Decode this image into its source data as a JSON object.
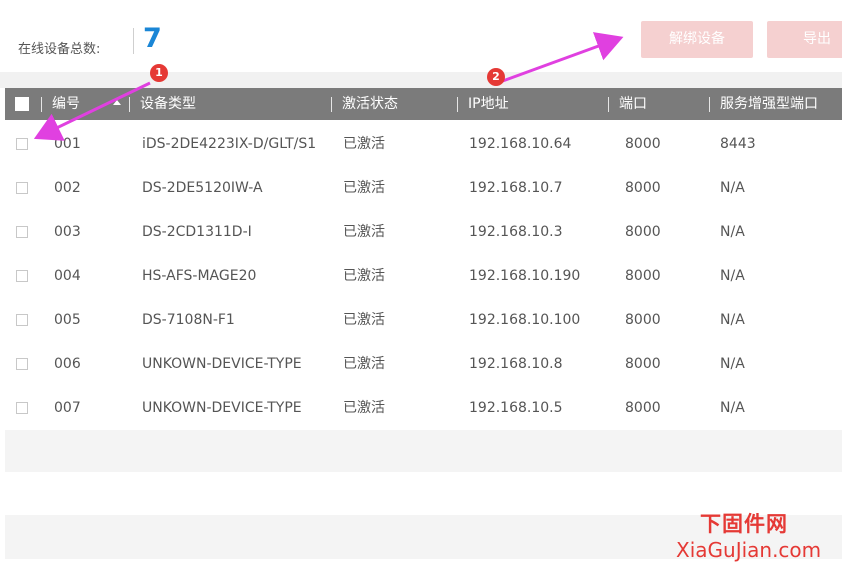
{
  "summary": {
    "online_label": "在线设备总数:",
    "online_count": "7"
  },
  "toolbar": {
    "unbind_label": "解绑设备",
    "export_label": "导出"
  },
  "table": {
    "columns": [
      "编号",
      "设备类型",
      "激活状态",
      "IP地址",
      "端口",
      "服务增强型端口"
    ],
    "rows": [
      {
        "id": "001",
        "type": "iDS-2DE4223IX-D/GLT/S1",
        "status": "已激活",
        "ip": "192.168.10.64",
        "port": "8000",
        "enhanced_port": "8443"
      },
      {
        "id": "002",
        "type": "DS-2DE5120IW-A",
        "status": "已激活",
        "ip": "192.168.10.7",
        "port": "8000",
        "enhanced_port": "N/A"
      },
      {
        "id": "003",
        "type": "DS-2CD1311D-I",
        "status": "已激活",
        "ip": "192.168.10.3",
        "port": "8000",
        "enhanced_port": "N/A"
      },
      {
        "id": "004",
        "type": "HS-AFS-MAGE20",
        "status": "已激活",
        "ip": "192.168.10.190",
        "port": "8000",
        "enhanced_port": "N/A"
      },
      {
        "id": "005",
        "type": "DS-7108N-F1",
        "status": "已激活",
        "ip": "192.168.10.100",
        "port": "8000",
        "enhanced_port": "N/A"
      },
      {
        "id": "006",
        "type": "UNKOWN-DEVICE-TYPE",
        "status": "已激活",
        "ip": "192.168.10.8",
        "port": "8000",
        "enhanced_port": "N/A"
      },
      {
        "id": "007",
        "type": "UNKOWN-DEVICE-TYPE",
        "status": "已激活",
        "ip": "192.168.10.5",
        "port": "8000",
        "enhanced_port": "N/A"
      }
    ]
  },
  "annotations": {
    "badge1": "1",
    "badge2": "2",
    "arrow_color": "#e040e0",
    "badge_color": "#e53935"
  },
  "watermark": {
    "cn": "下固件网",
    "en": "XiaGuJian.com"
  }
}
